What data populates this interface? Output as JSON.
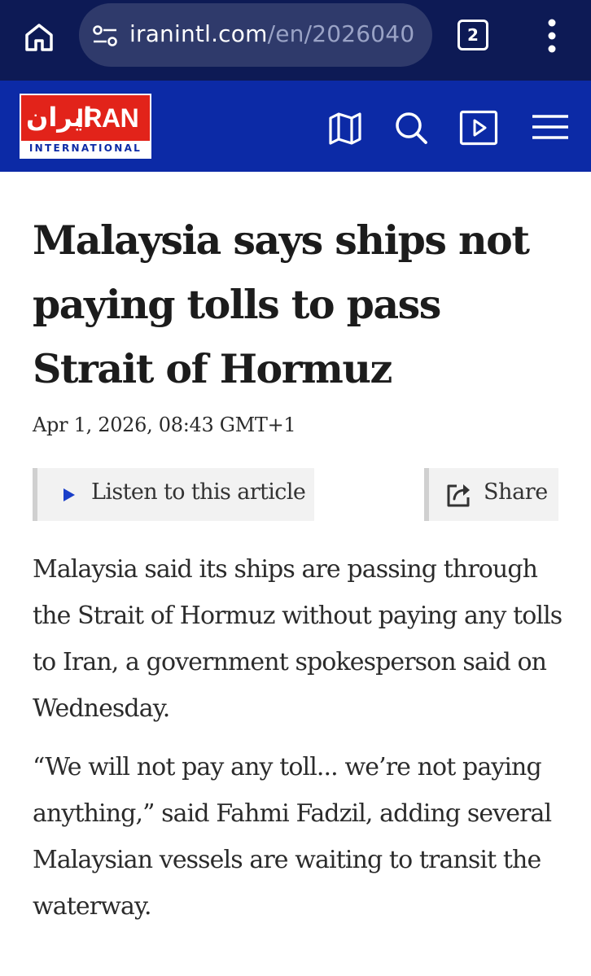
{
  "browser": {
    "url_host": "iranintl.com",
    "url_path": "/en/2026040",
    "tab_count": "2"
  },
  "site": {
    "logo_farsi": "ایران",
    "logo_main": "IRAN",
    "logo_sub": "INTERNATIONAL",
    "brand_color": "#0c2aa6",
    "logo_red": "#e2231a",
    "header_icons": [
      "map-icon",
      "search-icon",
      "video-play-icon",
      "hamburger-menu-icon"
    ]
  },
  "article": {
    "headline": "Malaysia says ships not paying tolls to pass Strait of Hormuz",
    "dateline": "Apr 1, 2026, 08:43 GMT+1",
    "listen_label": "Listen to this article",
    "share_label": "Share",
    "paragraphs": [
      "Malaysia said its ships are passing through the Strait of Hormuz without paying any tolls to Iran, a government spokesperson said on Wednesday.",
      "“We will not pay any toll... we’re not paying anything,” said Fahmi Fadzil, adding several Malaysian vessels are waiting to transit the waterway."
    ]
  }
}
